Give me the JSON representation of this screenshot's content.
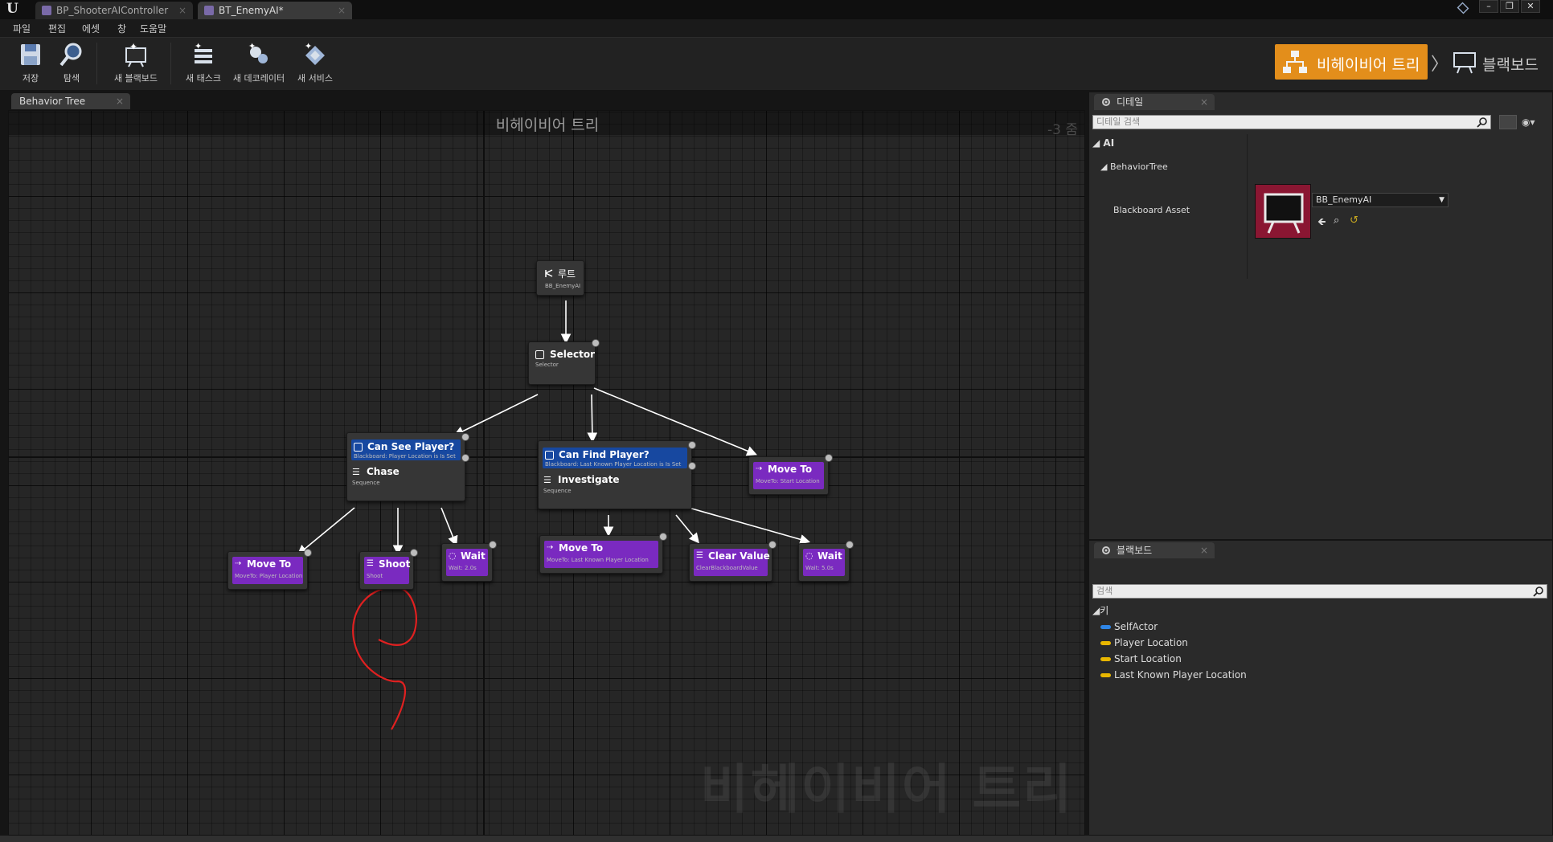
{
  "window": {
    "tabs": [
      {
        "label": "BP_ShooterAIController"
      },
      {
        "label": "BT_EnemyAI*"
      }
    ]
  },
  "menu": [
    "파일",
    "편집",
    "에셋",
    "창",
    "도움말"
  ],
  "toolbar": {
    "save": "저장",
    "browse": "탐색",
    "new_blackboard": "새 블랙보드",
    "new_task": "새 태스크",
    "new_decorator": "새 데코레이터",
    "new_service": "새 서비스"
  },
  "modes": {
    "behavior_tree": "비헤이비어 트리",
    "blackboard": "블랙보드",
    "active_color": "#e38e1b"
  },
  "graph": {
    "tab_label": "Behavior Tree",
    "title": "비헤이비어 트리",
    "zoom": "-3 줌",
    "watermark": "비헤이비어 트리",
    "nodes": {
      "root": {
        "title": "루트",
        "sub": "BB_EnemyAI"
      },
      "selector": {
        "title": "Selector",
        "sub": "Selector"
      },
      "can_see_player": {
        "decorator": "Can See Player?",
        "decorator_sub": "Blackboard: Player Location is Is Set",
        "title": "Chase",
        "sub": "Sequence"
      },
      "can_find_player": {
        "decorator": "Can Find Player?",
        "decorator_sub": "Blackboard: Last Known Player Location is Is Set",
        "title": "Investigate",
        "sub": "Sequence"
      },
      "move_to_start": {
        "title": "Move To",
        "sub": "MoveTo: Start Location"
      },
      "move_to_player": {
        "title": "Move To",
        "sub": "MoveTo: Player Location"
      },
      "shoot": {
        "title": "Shoot",
        "sub": "Shoot"
      },
      "wait_2": {
        "title": "Wait",
        "sub": "Wait: 2.0s"
      },
      "move_to_last_known": {
        "title": "Move To",
        "sub": "MoveTo: Last Known Player Location"
      },
      "clear_value": {
        "title": "Clear Value",
        "sub": "ClearBlackboardValue"
      },
      "wait_5": {
        "title": "Wait",
        "sub": "Wait: 5.0s"
      }
    }
  },
  "details": {
    "tab_label": "디테일",
    "search_placeholder": "디테일 검색",
    "category_ai": "AI",
    "subcategory": "BehaviorTree",
    "blackboard_asset_label": "Blackboard Asset",
    "blackboard_asset_value": "BB_EnemyAI"
  },
  "blackboard": {
    "tab_label": "블랙보드",
    "search_placeholder": "검색",
    "keys_header": "키",
    "keys": [
      {
        "name": "SelfActor",
        "color": "#2f86e6"
      },
      {
        "name": "Player Location",
        "color": "#e8b600"
      },
      {
        "name": "Start Location",
        "color": "#e8b600"
      },
      {
        "name": "Last Known Player Location",
        "color": "#e8b600"
      }
    ]
  },
  "colors": {
    "decorator": "#1748a0",
    "task": "#7a2ac0",
    "annotation": "#e02020"
  }
}
